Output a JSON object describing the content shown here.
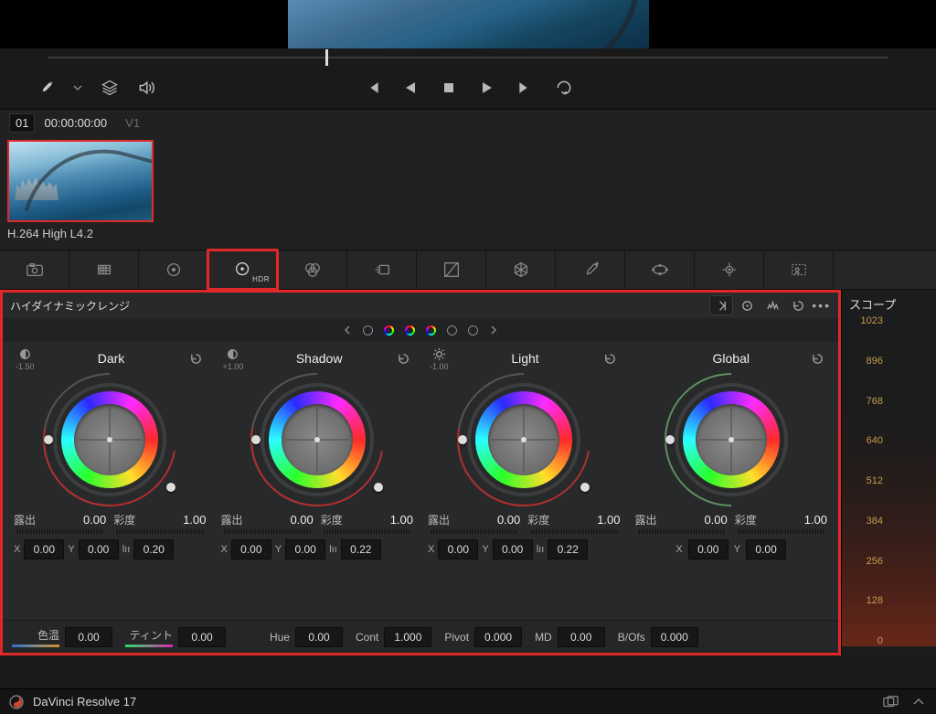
{
  "clip": {
    "index": "01",
    "timecode": "00:00:00:00",
    "track": "V1",
    "name": "H.264 High L4.2"
  },
  "palette_tabs": [
    "camera-raw",
    "color-match",
    "primaries",
    "hdr",
    "rgb-mixer",
    "motion-effects",
    "curves",
    "warper",
    "qualifier",
    "window",
    "tracker",
    "magic-mask"
  ],
  "active_tab": "hdr",
  "hdr": {
    "title": "ハイダイナミックレンジ",
    "wheels": [
      {
        "id": "dark",
        "label": "Dark",
        "adj": "-1.50",
        "exposure_label": "露出",
        "exposure": "0.00",
        "sat_label": "彩度",
        "sat": "1.00",
        "x": "0.00",
        "y": "0.00",
        "l": "0.20"
      },
      {
        "id": "shadow",
        "label": "Shadow",
        "adj": "+1.00",
        "exposure_label": "露出",
        "exposure": "0.00",
        "sat_label": "彩度",
        "sat": "1.00",
        "x": "0.00",
        "y": "0.00",
        "l": "0.22"
      },
      {
        "id": "light",
        "label": "Light",
        "adj": "-1.00",
        "exposure_label": "露出",
        "exposure": "0.00",
        "sat_label": "彩度",
        "sat": "1.00",
        "x": "0.00",
        "y": "0.00",
        "l": "0.22"
      },
      {
        "id": "global",
        "label": "Global",
        "adj": "",
        "exposure_label": "露出",
        "exposure": "0.00",
        "sat_label": "彩度",
        "sat": "1.00",
        "x": "0.00",
        "y": "0.00",
        "l": ""
      }
    ],
    "bottom": {
      "temp_label": "色温",
      "temp": "0.00",
      "tint_label": "ティント",
      "tint": "0.00",
      "hue_label": "Hue",
      "hue": "0.00",
      "cont_label": "Cont",
      "cont": "1.000",
      "pivot_label": "Pivot",
      "pivot": "0.000",
      "md_label": "MD",
      "md": "0.00",
      "bofs_label": "B/Ofs",
      "bofs": "0.000"
    }
  },
  "scope": {
    "title": "スコープ",
    "ticks": [
      "1023",
      "896",
      "768",
      "640",
      "512",
      "384",
      "256",
      "128",
      "0"
    ]
  },
  "footer": {
    "app": "DaVinci Resolve 17"
  }
}
